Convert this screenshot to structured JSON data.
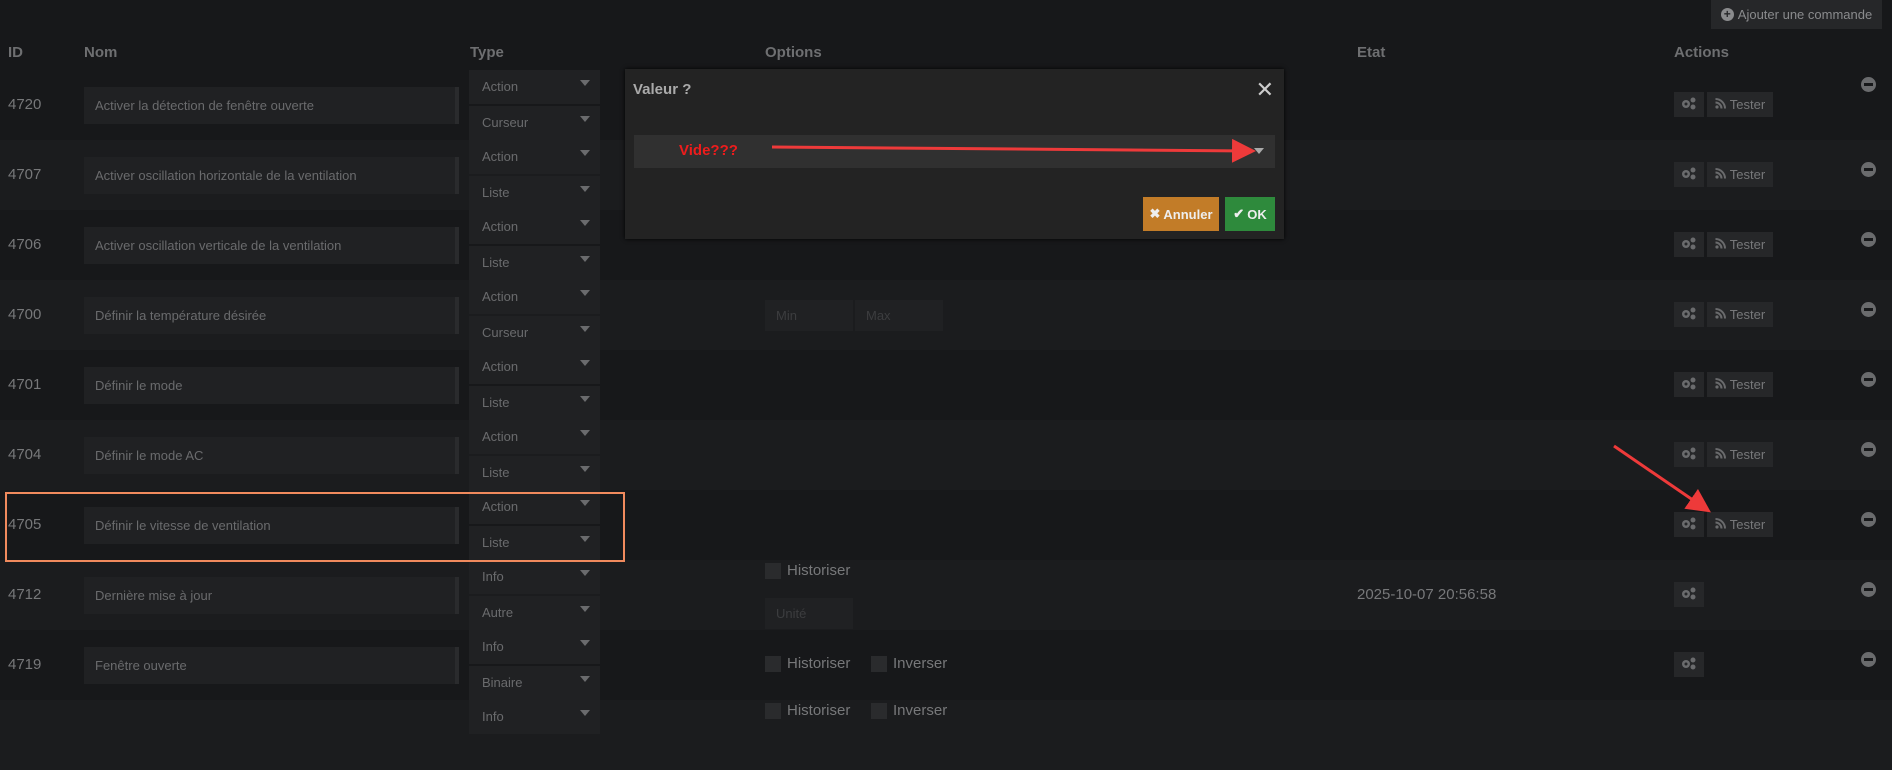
{
  "toolbar": {
    "add_label": "Ajouter une commande"
  },
  "headers": {
    "id": "ID",
    "nom": "Nom",
    "type": "Type",
    "options": "Options",
    "etat": "Etat",
    "actions": "Actions"
  },
  "rows": [
    {
      "id": "4720",
      "name": "Activer la détection de fenêtre ouverte",
      "type": "Action",
      "subtype": "Curseur",
      "tester": "Tester"
    },
    {
      "id": "4707",
      "name": "Activer oscillation horizontale de la ventilation",
      "type": "Action",
      "subtype": "Liste",
      "tester": "Tester"
    },
    {
      "id": "4706",
      "name": "Activer oscillation verticale de la ventilation",
      "type": "Action",
      "subtype": "Liste",
      "tester": "Tester"
    },
    {
      "id": "4700",
      "name": "Définir la température désirée",
      "type": "Action",
      "subtype": "Curseur",
      "tester": "Tester",
      "min_placeholder": "Min",
      "max_placeholder": "Max"
    },
    {
      "id": "4701",
      "name": "Définir le mode",
      "type": "Action",
      "subtype": "Liste",
      "tester": "Tester"
    },
    {
      "id": "4704",
      "name": "Définir le mode AC",
      "type": "Action",
      "subtype": "Liste",
      "tester": "Tester"
    },
    {
      "id": "4705",
      "name": "Définir le vitesse de ventilation",
      "type": "Action",
      "subtype": "Liste",
      "tester": "Tester"
    },
    {
      "id": "4712",
      "name": "Dernière mise à jour",
      "type": "Info",
      "subtype": "Autre",
      "historiser": "Historiser",
      "unit_placeholder": "Unité",
      "etat": "2025-10-07 20:56:58"
    },
    {
      "id": "4719",
      "name": "Fenêtre ouverte",
      "type": "Info",
      "subtype": "Binaire",
      "historiser": "Historiser",
      "inverser": "Inverser"
    },
    {
      "id": "",
      "name": "",
      "type": "Info",
      "subtype": "",
      "historiser": "Historiser",
      "inverser": "Inverser"
    }
  ],
  "modal": {
    "title": "Valeur ?",
    "select_value": "Vide???",
    "cancel_label": "Annuler",
    "ok_label": "OK"
  },
  "colors": {
    "annotation": "#ee3a3a",
    "highlight": "#f08a5d",
    "cancel": "#c27c28",
    "ok": "#2e8a3c"
  }
}
